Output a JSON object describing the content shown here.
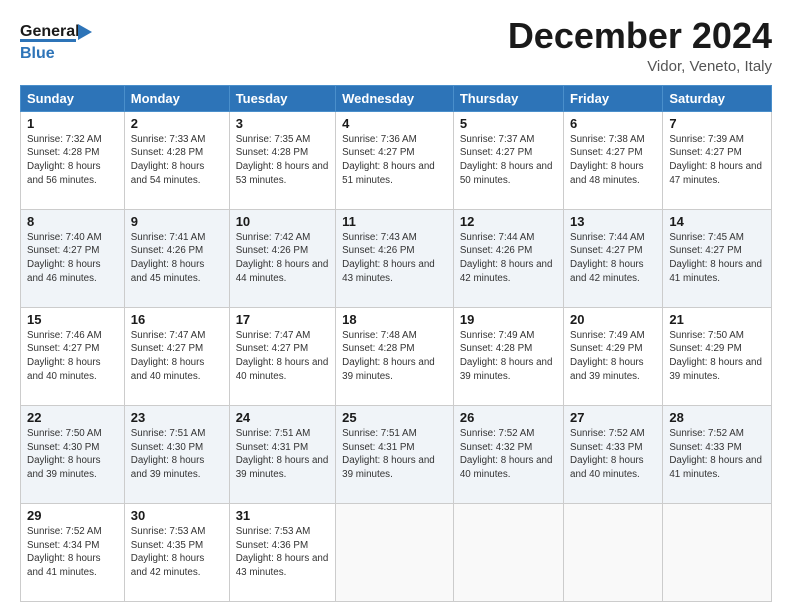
{
  "header": {
    "logo_line1": "General",
    "logo_line2": "Blue",
    "title": "December 2024",
    "subtitle": "Vidor, Veneto, Italy"
  },
  "weekdays": [
    "Sunday",
    "Monday",
    "Tuesday",
    "Wednesday",
    "Thursday",
    "Friday",
    "Saturday"
  ],
  "weeks": [
    [
      {
        "day": "1",
        "sunrise": "Sunrise: 7:32 AM",
        "sunset": "Sunset: 4:28 PM",
        "daylight": "Daylight: 8 hours and 56 minutes."
      },
      {
        "day": "2",
        "sunrise": "Sunrise: 7:33 AM",
        "sunset": "Sunset: 4:28 PM",
        "daylight": "Daylight: 8 hours and 54 minutes."
      },
      {
        "day": "3",
        "sunrise": "Sunrise: 7:35 AM",
        "sunset": "Sunset: 4:28 PM",
        "daylight": "Daylight: 8 hours and 53 minutes."
      },
      {
        "day": "4",
        "sunrise": "Sunrise: 7:36 AM",
        "sunset": "Sunset: 4:27 PM",
        "daylight": "Daylight: 8 hours and 51 minutes."
      },
      {
        "day": "5",
        "sunrise": "Sunrise: 7:37 AM",
        "sunset": "Sunset: 4:27 PM",
        "daylight": "Daylight: 8 hours and 50 minutes."
      },
      {
        "day": "6",
        "sunrise": "Sunrise: 7:38 AM",
        "sunset": "Sunset: 4:27 PM",
        "daylight": "Daylight: 8 hours and 48 minutes."
      },
      {
        "day": "7",
        "sunrise": "Sunrise: 7:39 AM",
        "sunset": "Sunset: 4:27 PM",
        "daylight": "Daylight: 8 hours and 47 minutes."
      }
    ],
    [
      {
        "day": "8",
        "sunrise": "Sunrise: 7:40 AM",
        "sunset": "Sunset: 4:27 PM",
        "daylight": "Daylight: 8 hours and 46 minutes."
      },
      {
        "day": "9",
        "sunrise": "Sunrise: 7:41 AM",
        "sunset": "Sunset: 4:26 PM",
        "daylight": "Daylight: 8 hours and 45 minutes."
      },
      {
        "day": "10",
        "sunrise": "Sunrise: 7:42 AM",
        "sunset": "Sunset: 4:26 PM",
        "daylight": "Daylight: 8 hours and 44 minutes."
      },
      {
        "day": "11",
        "sunrise": "Sunrise: 7:43 AM",
        "sunset": "Sunset: 4:26 PM",
        "daylight": "Daylight: 8 hours and 43 minutes."
      },
      {
        "day": "12",
        "sunrise": "Sunrise: 7:44 AM",
        "sunset": "Sunset: 4:26 PM",
        "daylight": "Daylight: 8 hours and 42 minutes."
      },
      {
        "day": "13",
        "sunrise": "Sunrise: 7:44 AM",
        "sunset": "Sunset: 4:27 PM",
        "daylight": "Daylight: 8 hours and 42 minutes."
      },
      {
        "day": "14",
        "sunrise": "Sunrise: 7:45 AM",
        "sunset": "Sunset: 4:27 PM",
        "daylight": "Daylight: 8 hours and 41 minutes."
      }
    ],
    [
      {
        "day": "15",
        "sunrise": "Sunrise: 7:46 AM",
        "sunset": "Sunset: 4:27 PM",
        "daylight": "Daylight: 8 hours and 40 minutes."
      },
      {
        "day": "16",
        "sunrise": "Sunrise: 7:47 AM",
        "sunset": "Sunset: 4:27 PM",
        "daylight": "Daylight: 8 hours and 40 minutes."
      },
      {
        "day": "17",
        "sunrise": "Sunrise: 7:47 AM",
        "sunset": "Sunset: 4:27 PM",
        "daylight": "Daylight: 8 hours and 40 minutes."
      },
      {
        "day": "18",
        "sunrise": "Sunrise: 7:48 AM",
        "sunset": "Sunset: 4:28 PM",
        "daylight": "Daylight: 8 hours and 39 minutes."
      },
      {
        "day": "19",
        "sunrise": "Sunrise: 7:49 AM",
        "sunset": "Sunset: 4:28 PM",
        "daylight": "Daylight: 8 hours and 39 minutes."
      },
      {
        "day": "20",
        "sunrise": "Sunrise: 7:49 AM",
        "sunset": "Sunset: 4:29 PM",
        "daylight": "Daylight: 8 hours and 39 minutes."
      },
      {
        "day": "21",
        "sunrise": "Sunrise: 7:50 AM",
        "sunset": "Sunset: 4:29 PM",
        "daylight": "Daylight: 8 hours and 39 minutes."
      }
    ],
    [
      {
        "day": "22",
        "sunrise": "Sunrise: 7:50 AM",
        "sunset": "Sunset: 4:30 PM",
        "daylight": "Daylight: 8 hours and 39 minutes."
      },
      {
        "day": "23",
        "sunrise": "Sunrise: 7:51 AM",
        "sunset": "Sunset: 4:30 PM",
        "daylight": "Daylight: 8 hours and 39 minutes."
      },
      {
        "day": "24",
        "sunrise": "Sunrise: 7:51 AM",
        "sunset": "Sunset: 4:31 PM",
        "daylight": "Daylight: 8 hours and 39 minutes."
      },
      {
        "day": "25",
        "sunrise": "Sunrise: 7:51 AM",
        "sunset": "Sunset: 4:31 PM",
        "daylight": "Daylight: 8 hours and 39 minutes."
      },
      {
        "day": "26",
        "sunrise": "Sunrise: 7:52 AM",
        "sunset": "Sunset: 4:32 PM",
        "daylight": "Daylight: 8 hours and 40 minutes."
      },
      {
        "day": "27",
        "sunrise": "Sunrise: 7:52 AM",
        "sunset": "Sunset: 4:33 PM",
        "daylight": "Daylight: 8 hours and 40 minutes."
      },
      {
        "day": "28",
        "sunrise": "Sunrise: 7:52 AM",
        "sunset": "Sunset: 4:33 PM",
        "daylight": "Daylight: 8 hours and 41 minutes."
      }
    ],
    [
      {
        "day": "29",
        "sunrise": "Sunrise: 7:52 AM",
        "sunset": "Sunset: 4:34 PM",
        "daylight": "Daylight: 8 hours and 41 minutes."
      },
      {
        "day": "30",
        "sunrise": "Sunrise: 7:53 AM",
        "sunset": "Sunset: 4:35 PM",
        "daylight": "Daylight: 8 hours and 42 minutes."
      },
      {
        "day": "31",
        "sunrise": "Sunrise: 7:53 AM",
        "sunset": "Sunset: 4:36 PM",
        "daylight": "Daylight: 8 hours and 43 minutes."
      },
      null,
      null,
      null,
      null
    ]
  ]
}
